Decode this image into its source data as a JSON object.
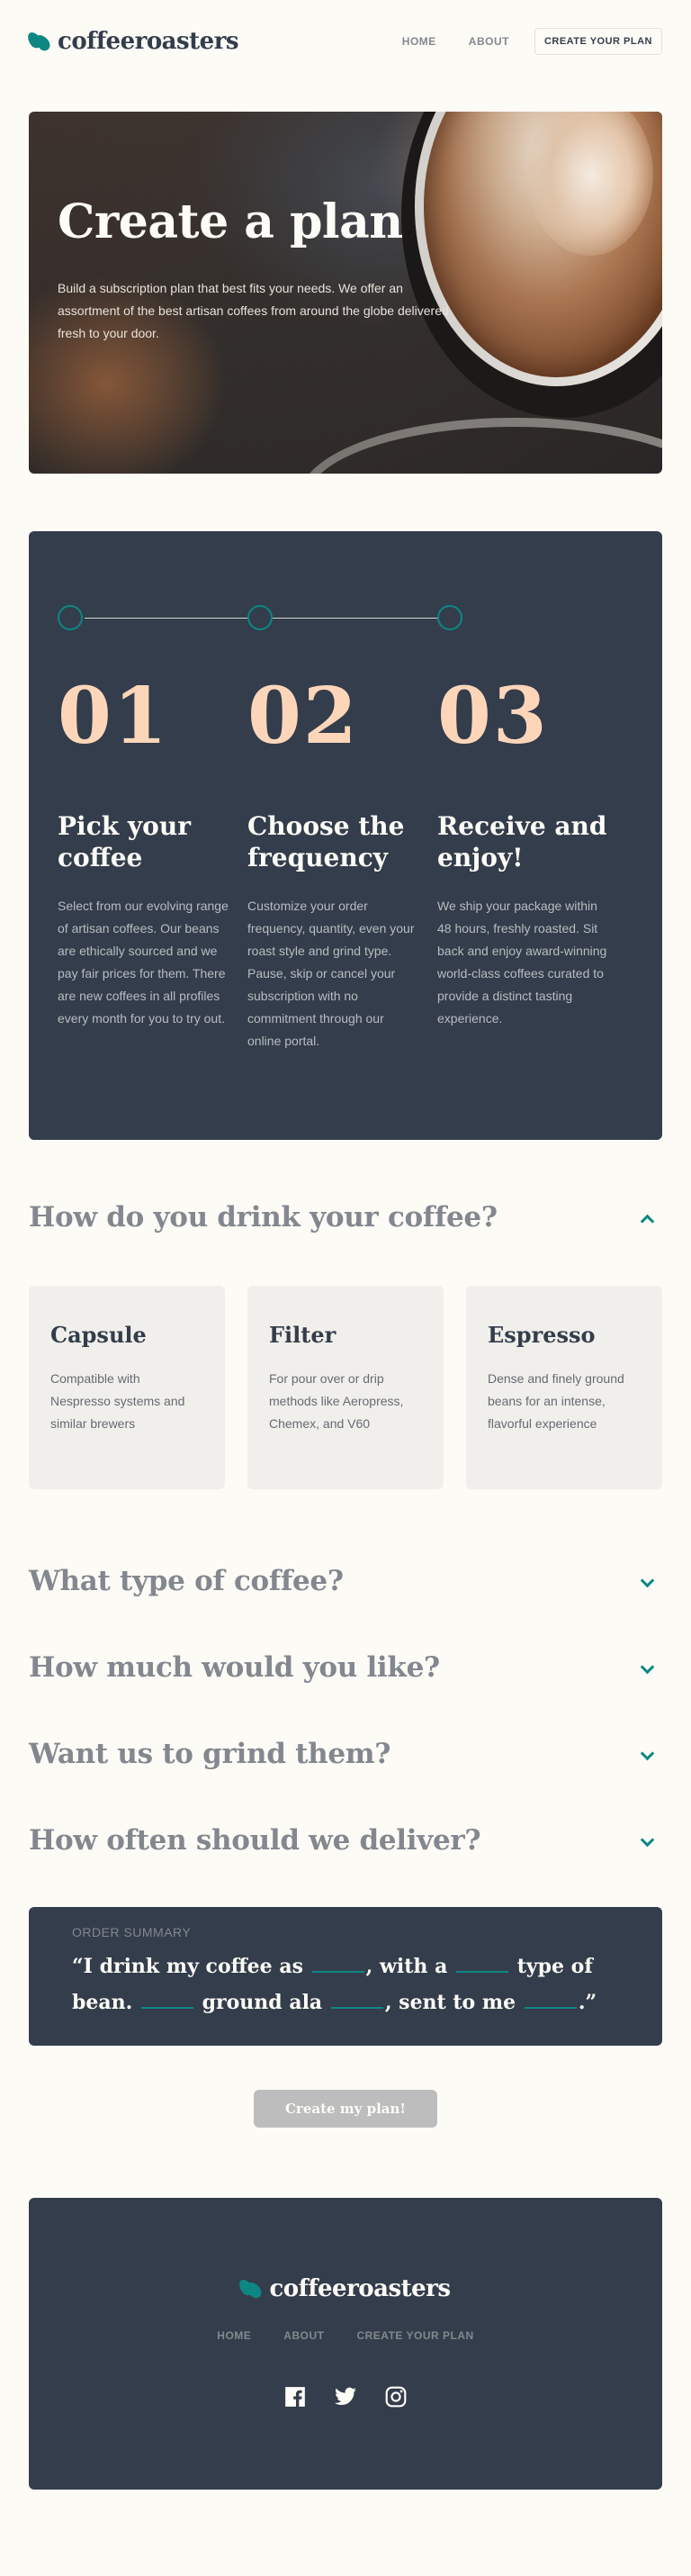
{
  "header": {
    "logo_text": "coffeeroasters",
    "nav": [
      {
        "label": "HOME"
      },
      {
        "label": "ABOUT"
      },
      {
        "label": "CREATE YOUR PLAN"
      }
    ]
  },
  "hero": {
    "title": "Create a plan",
    "text": "Build a subscription plan that best fits your needs. We offer an assortment of the best artisan coffees from around the globe delivered fresh to your door."
  },
  "steps": [
    {
      "number": "01",
      "title": "Pick your coffee",
      "text": "Select from our evolving range of artisan coffees. Our beans are ethically sourced and we pay fair prices for them. There are new coffees in all profiles every month for you to try out."
    },
    {
      "number": "02",
      "title": "Choose the frequency",
      "text": "Customize your order frequency, quantity, even your roast style and grind type. Pause, skip or cancel your subscription with no commitment through our online portal."
    },
    {
      "number": "03",
      "title": "Receive and enjoy!",
      "text": "We ship your package within 48 hours, freshly roasted. Sit back and enjoy award-winning world-class coffees curated to provide a distinct tasting experience."
    }
  ],
  "questions": [
    {
      "title": "How do you drink your coffee?",
      "expanded": true,
      "options": [
        {
          "title": "Capsule",
          "text": "Compatible with Nespresso systems and similar brewers"
        },
        {
          "title": "Filter",
          "text": "For pour over or drip methods like Aeropress, Chemex, and V60"
        },
        {
          "title": "Espresso",
          "text": "Dense and finely ground beans for an intense, flavorful experience"
        }
      ]
    },
    {
      "title": "What type of coffee?",
      "expanded": false
    },
    {
      "title": "How much would you like?",
      "expanded": false
    },
    {
      "title": "Want us to grind them?",
      "expanded": false
    },
    {
      "title": "How often should we deliver?",
      "expanded": false
    }
  ],
  "summary": {
    "label": "ORDER SUMMARY",
    "parts": [
      "“I drink my coffee as",
      ", with a",
      "type of bean.",
      "ground ala",
      ", sent to me",
      ".”"
    ]
  },
  "create_button": "Create my plan!",
  "footer": {
    "logo_text": "coffeeroasters",
    "nav": [
      {
        "label": "HOME"
      },
      {
        "label": "ABOUT"
      },
      {
        "label": "CREATE YOUR PLAN"
      }
    ],
    "social": [
      "facebook-icon",
      "twitter-icon",
      "instagram-icon"
    ]
  },
  "colors": {
    "accent": "#0e8784",
    "dark": "#333d4b",
    "peach": "#fdd6ba",
    "background": "#fdfbf6"
  }
}
